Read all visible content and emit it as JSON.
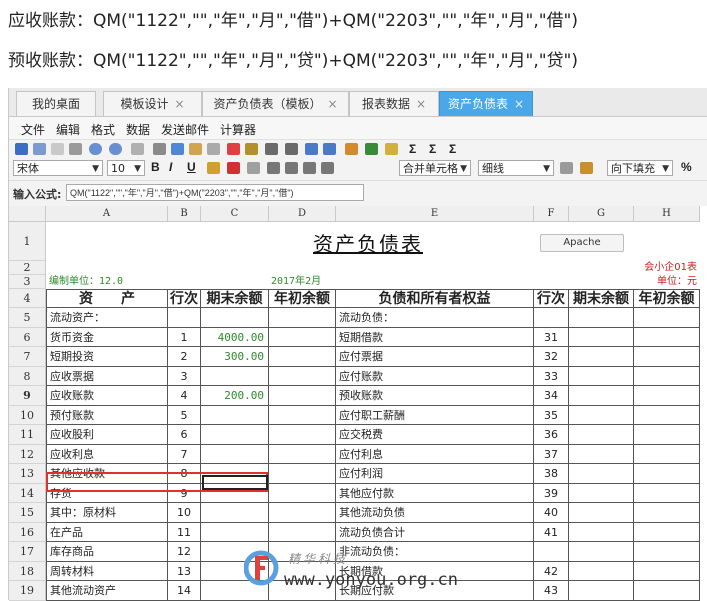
{
  "formulas": {
    "receivable": "应收账款：QM(\"1122\",\"\",\"年\",\"月\",\"借\")+QM(\"2203\",\"\",\"年\",\"月\",\"借\")",
    "advance": "预收账款：QM(\"1122\",\"\",\"年\",\"月\",\"贷\")+QM(\"2203\",\"\",\"年\",\"月\",\"贷\")"
  },
  "tabs": [
    {
      "label": "我的桌面",
      "closable": false
    },
    {
      "label": "模板设计",
      "closable": true
    },
    {
      "label": "资产负债表（模板）",
      "closable": true
    },
    {
      "label": "报表数据",
      "closable": true
    },
    {
      "label": "资产负债表",
      "closable": true,
      "active": true
    }
  ],
  "tab_close_glyph": "×",
  "menu": [
    "文件",
    "编辑",
    "格式",
    "数据",
    "发送邮件",
    "计算器"
  ],
  "toolbar": {
    "font": "宋体",
    "font_size": "10",
    "bold": "B",
    "italic": "I",
    "underline": "U",
    "merge": "合并单元格",
    "border": "细线",
    "fill": "向下填充",
    "percent": "%",
    "sum": "Σ"
  },
  "formula_bar": {
    "label": "输入公式:",
    "value": "QM(\"1122\",\"\",\"年\",\"月\",\"借\")+QM(\"2203\",\"\",\"年\",\"月\",\"借\")"
  },
  "columns": [
    "A",
    "B",
    "C",
    "D",
    "E",
    "F",
    "G",
    "H"
  ],
  "sheet": {
    "title": "资产负债表",
    "apache_button": "Apache",
    "form_code": "会小企01表",
    "compiler": "编制单位：12.0",
    "period": "2017年2月",
    "unit": "单位：元",
    "headers": {
      "asset": "资　　产",
      "line": "行次",
      "end": "期末余额",
      "begin": "年初余额",
      "liability": "负债和所有者权益",
      "line2": "行次",
      "end2": "期末余额",
      "begin2": "年初余额"
    },
    "rows": [
      {
        "r": "5",
        "a": "流动资产：",
        "b": "",
        "c": "",
        "e": "流动负债：",
        "f": ""
      },
      {
        "r": "6",
        "a": "货币资金",
        "b": "1",
        "c": "4000.00",
        "e": "短期借款",
        "f": "31"
      },
      {
        "r": "7",
        "a": "短期投资",
        "b": "2",
        "c": "300.00",
        "e": "应付票据",
        "f": "32"
      },
      {
        "r": "8",
        "a": "应收票据",
        "b": "3",
        "c": "",
        "e": "应付账款",
        "f": "33"
      },
      {
        "r": "9",
        "a": "应收账款",
        "b": "4",
        "c": "200.00",
        "e": "预收账款",
        "f": "34"
      },
      {
        "r": "10",
        "a": "预付账款",
        "b": "5",
        "c": "",
        "e": "应付职工薪酬",
        "f": "35"
      },
      {
        "r": "11",
        "a": "应收股利",
        "b": "6",
        "c": "",
        "e": "应交税费",
        "f": "36"
      },
      {
        "r": "12",
        "a": "应收利息",
        "b": "7",
        "c": "",
        "e": "应付利息",
        "f": "37"
      },
      {
        "r": "13",
        "a": "其他应收款",
        "b": "8",
        "c": "",
        "e": "应付利润",
        "f": "38"
      },
      {
        "r": "14",
        "a": "存货",
        "b": "9",
        "c": "",
        "e": "其他应付款",
        "f": "39"
      },
      {
        "r": "15",
        "a": "其中：原材料",
        "b": "10",
        "c": "",
        "e": "其他流动负债",
        "f": "40"
      },
      {
        "r": "16",
        "a": "在产品",
        "b": "11",
        "c": "",
        "e": "流动负债合计",
        "f": "41"
      },
      {
        "r": "17",
        "a": "库存商品",
        "b": "12",
        "c": "",
        "e": "非流动负债：",
        "f": ""
      },
      {
        "r": "18",
        "a": "周转材料",
        "b": "13",
        "c": "",
        "e": "长期借款",
        "f": "42"
      },
      {
        "r": "19",
        "a": "其他流动资产",
        "b": "14",
        "c": "",
        "e": "长期应付款",
        "f": "43"
      }
    ]
  },
  "watermark": {
    "cn": "精华科技",
    "url": "www.yonyou.org.cn"
  },
  "colors": {
    "active_tab": "#4aa7e8",
    "highlight": "#e03030",
    "value_green": "#2e8b2e",
    "red_text": "#d02020"
  }
}
